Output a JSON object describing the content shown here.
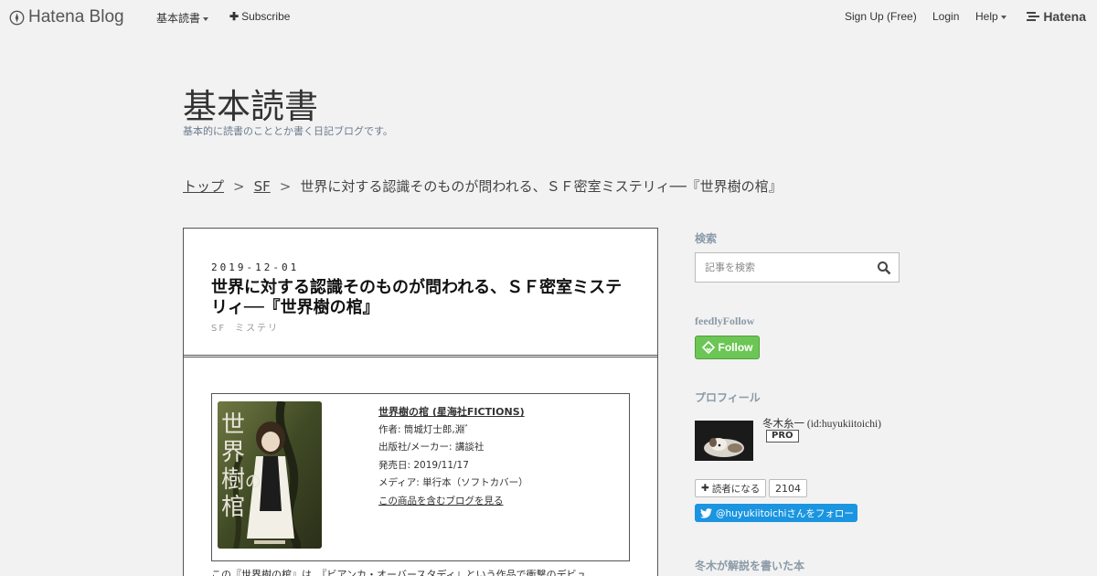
{
  "topbar": {
    "brand": "Hatena Blog",
    "blog_menu": "基本読書",
    "subscribe": "Subscribe",
    "signup": "Sign Up (Free)",
    "login": "Login",
    "help": "Help",
    "hatena": "Hatena"
  },
  "blog": {
    "title": "基本読書",
    "description": "基本的に読書のこととか書く日記ブログです。"
  },
  "breadcrumb": {
    "items": [
      "トップ",
      "SF",
      "世界に対する認識そのものが問われる、ＳＦ密室ミステリィ──『世界樹の棺』"
    ],
    "separator": ">"
  },
  "article": {
    "date": "2019-12-01",
    "title": "世界に対する認識そのものが問われる、ＳＦ密室ミステリィ──『世界樹の棺』",
    "categories": [
      "SF",
      "ミステリ"
    ],
    "product": {
      "title": "世界樹の棺 (星海社FICTIONS)",
      "author": "作者: 筒城灯士郎,淵゛",
      "publisher": "出版社/メーカー: 講談社",
      "release": "発売日: 2019/11/17",
      "media": "メディア: 単行本（ソフトカバー）",
      "link": "この商品を含むブログを見る",
      "cover_text": "世界樹の棺"
    },
    "body_start": "この『世界樹の棺』は、『ビアンカ・オーバースタディ』という作品で衝撃のデビュ"
  },
  "sidebar": {
    "search_heading": "検索",
    "search_placeholder": "記事を検索",
    "feedly_heading": "feedlyFollow",
    "feedly_button": "Follow",
    "profile_heading": "プロフィール",
    "profile_name": "冬木糸一 (id:huyukiitoichi)",
    "pro_badge": "PRO",
    "reader_button": "読者になる",
    "reader_count": "2104",
    "twitter_button": "@huyukiitoichiさんをフォロー",
    "books_heading": "冬木が解説を書いた本"
  },
  "colors": {
    "background": "#f2f2f2",
    "sidebar_heading": "#8a9aa8",
    "feedly_green": "#6cc655",
    "twitter_blue": "#1b95e0"
  }
}
